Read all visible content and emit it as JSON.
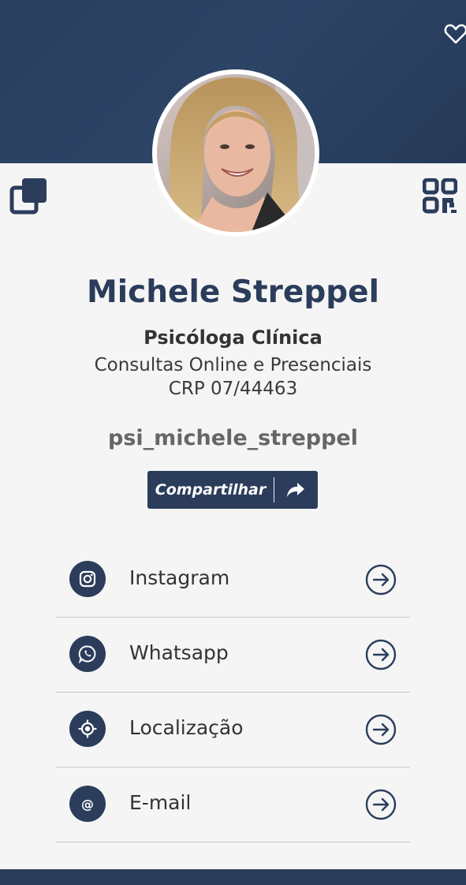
{
  "profile": {
    "name": "Michele Streppel",
    "profession": "Psicóloga Clínica",
    "subtitle": "Consultas Online e Presenciais",
    "crp": "CRP 07/44463",
    "username": "psi_michele_streppel"
  },
  "share": {
    "label": "Compartilhar",
    "icon": "share-arrow-icon"
  },
  "links": [
    {
      "label": "Instagram",
      "icon": "instagram-icon"
    },
    {
      "label": "Whatsapp",
      "icon": "whatsapp-icon"
    },
    {
      "label": "Localização",
      "icon": "location-icon"
    },
    {
      "label": "E-mail",
      "icon": "at-icon",
      "glyph": "@"
    }
  ],
  "colors": {
    "primary": "#2b3d5b",
    "background": "#f5f5f5",
    "header": "#2d4466"
  }
}
